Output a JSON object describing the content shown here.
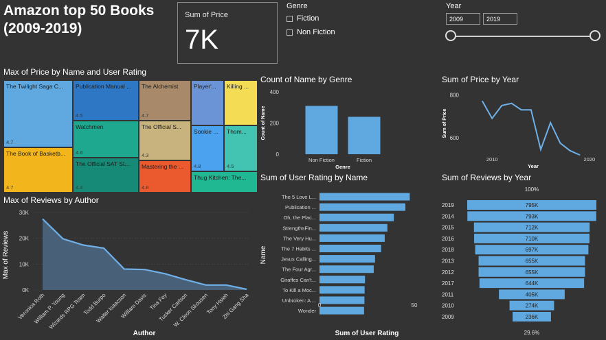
{
  "dashboard": {
    "title_line1": "Amazon top 50 Books",
    "title_line2": "(2009-2019)"
  },
  "card": {
    "label": "Sum of Price",
    "value": "7K"
  },
  "genre_slicer": {
    "title": "Genre",
    "options": [
      "Fiction",
      "Non Fiction"
    ]
  },
  "year_slicer": {
    "title": "Year",
    "from": "2009",
    "to": "2019",
    "range": [
      2009,
      2019
    ]
  },
  "colors": {
    "background": "#333333",
    "bar": "#5fa8e0",
    "area_fill": "#4a6680",
    "line": "#6fb0e8"
  },
  "chart_data": [
    {
      "id": "treemap",
      "type": "treemap",
      "title": "Max of Price by Name and User Rating",
      "cells": [
        {
          "name": "The Twilight Saga C...",
          "value": "4.7",
          "color": "#5fa8e0"
        },
        {
          "name": "The Book of Basketb...",
          "value": "4.7",
          "color": "#f2b51c"
        },
        {
          "name": "Publication Manual ...",
          "value": "4.5",
          "color": "#2e77c4"
        },
        {
          "name": "Watchmen",
          "value": "4.8",
          "color": "#1ea88f"
        },
        {
          "name": "The Official SAT St...",
          "value": "4.4",
          "color": "#168a76"
        },
        {
          "name": "The Alchemist",
          "value": "4.7",
          "color": "#a88a6a"
        },
        {
          "name": "The Official S...",
          "value": "4.3",
          "color": "#c8b27e"
        },
        {
          "name": "Mastering the ...",
          "value": "4.8",
          "color": "#eb5a2e"
        },
        {
          "name": "Player'...",
          "value": "",
          "color": "#6b94d6"
        },
        {
          "name": "Sookie ...",
          "value": "4.8",
          "color": "#4ba3f0"
        },
        {
          "name": "Killing ...",
          "value": "",
          "color": "#f5dc55"
        },
        {
          "name": "Thom...",
          "value": "4.5",
          "color": "#43c4b3"
        },
        {
          "name": "Thug Kitchen: The...",
          "value": "",
          "color": "#1fb893"
        }
      ]
    },
    {
      "id": "genre",
      "type": "bar",
      "title": "Count of Name by Genre",
      "xlabel": "Genre",
      "ylabel": "Count of Name",
      "categories": [
        "Non Fiction",
        "Fiction"
      ],
      "values": [
        310,
        240
      ],
      "ylim": [
        0,
        400
      ],
      "yticks": [
        "0",
        "200",
        "400"
      ]
    },
    {
      "id": "price_year",
      "type": "line",
      "title": "Sum of Price by Year",
      "xlabel": "Year",
      "ylabel": "Sum of Price",
      "x": [
        2009,
        2010,
        2011,
        2012,
        2013,
        2014,
        2015,
        2016,
        2017,
        2018,
        2019
      ],
      "values": [
        770,
        690,
        750,
        760,
        730,
        730,
        545,
        670,
        575,
        540,
        520
      ],
      "ylim": [
        520,
        820
      ],
      "yticks": [
        "800",
        "600"
      ],
      "xticks": [
        "2010",
        "2020"
      ]
    },
    {
      "id": "reviews_author",
      "type": "area",
      "title": "Max of Reviews by Author",
      "xlabel": "Author",
      "ylabel": "Max of Reviews",
      "categories": [
        "Veronica Roth",
        "William P. Young",
        "Wizards RPG Team",
        "Todd Burpo",
        "Walter Isaacson",
        "William Davis",
        "Tina Fey",
        "Tucker Carlson",
        "W. Cleon Skousen",
        "Tony Hsieh",
        "Zhi Gang Sha"
      ],
      "values": [
        27500,
        19800,
        17400,
        16200,
        8100,
        7900,
        6300,
        4000,
        1900,
        1900,
        300
      ],
      "ylim": [
        0,
        30000
      ],
      "yticks": [
        "0K",
        "10K",
        "20K",
        "30K"
      ]
    },
    {
      "id": "rating_name",
      "type": "bar",
      "title": "Sum of User Rating by Name",
      "xlabel": "Sum of User Rating",
      "ylabel": "Name",
      "categories": [
        "The 5 Love L...",
        "Publication ...",
        "Oh, the Plac...",
        "StrengthsFin...",
        "The Very Hu...",
        "The 7 Habits ...",
        "Jesus Calling...",
        "The Four Agr...",
        "Giraffes Can't...",
        "To Kill a Moc...",
        "Unbroken: A ...",
        "Wonder"
      ],
      "values": [
        47.6,
        45.3,
        39.2,
        35.8,
        34.4,
        32.5,
        29.3,
        28.6,
        24.0,
        23.8,
        23.7,
        23.5
      ],
      "xlim": [
        0,
        50
      ],
      "xticks": [
        "0",
        "50"
      ]
    },
    {
      "id": "reviews_year",
      "type": "funnel",
      "title": "Sum of Reviews by Year",
      "top_label": "100%",
      "bottom_label": "29.6%",
      "categories": [
        "2019",
        "2014",
        "2015",
        "2016",
        "2018",
        "2013",
        "2012",
        "2017",
        "2011",
        "2010",
        "2009"
      ],
      "values": [
        795,
        793,
        712,
        710,
        697,
        655,
        655,
        644,
        405,
        274,
        236
      ],
      "labels": [
        "795K",
        "793K",
        "712K",
        "710K",
        "697K",
        "655K",
        "655K",
        "644K",
        "405K",
        "274K",
        "236K"
      ]
    }
  ]
}
